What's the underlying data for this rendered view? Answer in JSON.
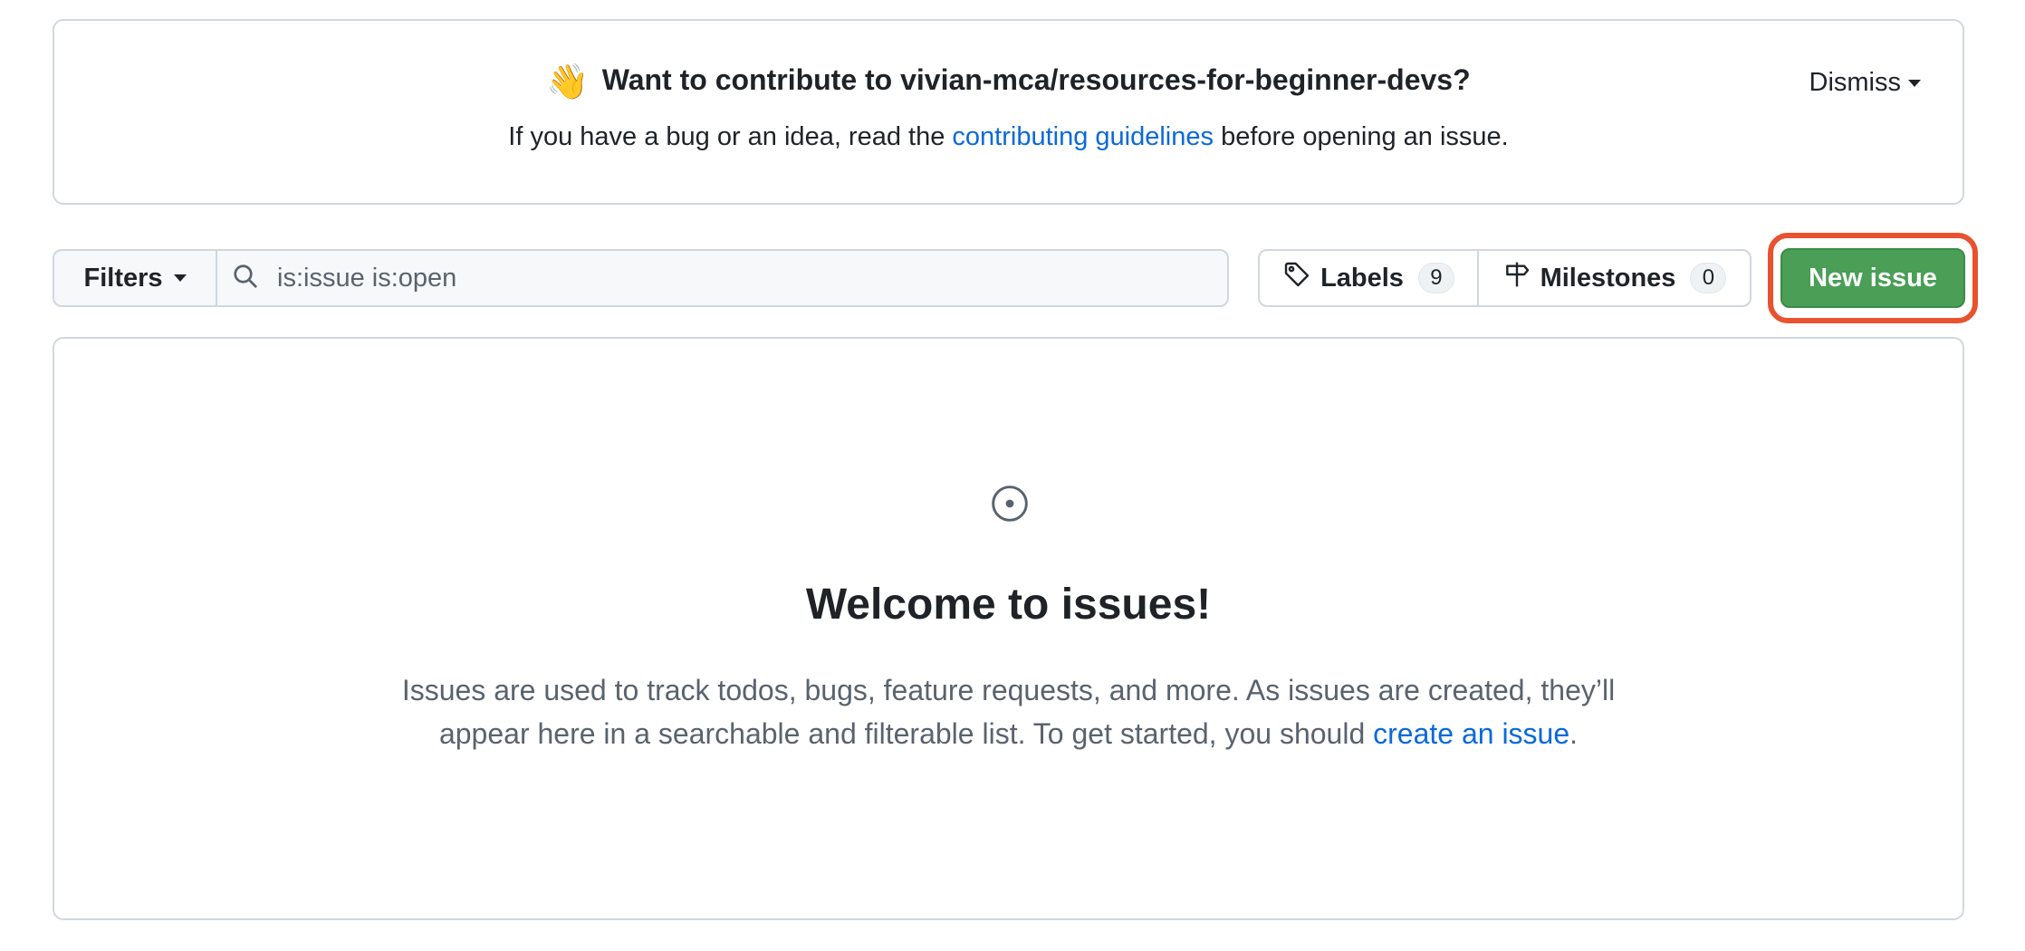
{
  "banner": {
    "emoji": "👋",
    "title": "Want to contribute to vivian-mca/resources-for-beginner-devs?",
    "body_prefix": "If you have a bug or an idea, read the ",
    "body_link": "contributing guidelines",
    "body_suffix": " before opening an issue.",
    "dismiss_label": "Dismiss"
  },
  "toolbar": {
    "filters_label": "Filters",
    "search_value": "is:issue is:open",
    "labels_label": "Labels",
    "labels_count": "9",
    "milestones_label": "Milestones",
    "milestones_count": "0",
    "new_issue_label": "New issue"
  },
  "empty_state": {
    "title": "Welcome to issues!",
    "text_line1": "Issues are used to track todos, bugs, feature requests, and more. As issues are created, they’ll",
    "text_line2_prefix": "appear here in a searchable and filterable list. To get started, you should ",
    "text_link": "create an issue",
    "text_suffix": "."
  },
  "colors": {
    "link": "#0969da",
    "primary_button": "#4a9e56",
    "highlight": "#e8522f",
    "border": "#d0d7de"
  },
  "icons": [
    "wave-emoji",
    "caret-down-icon",
    "search-icon",
    "tag-icon",
    "milestone-icon",
    "issue-opened-icon"
  ]
}
